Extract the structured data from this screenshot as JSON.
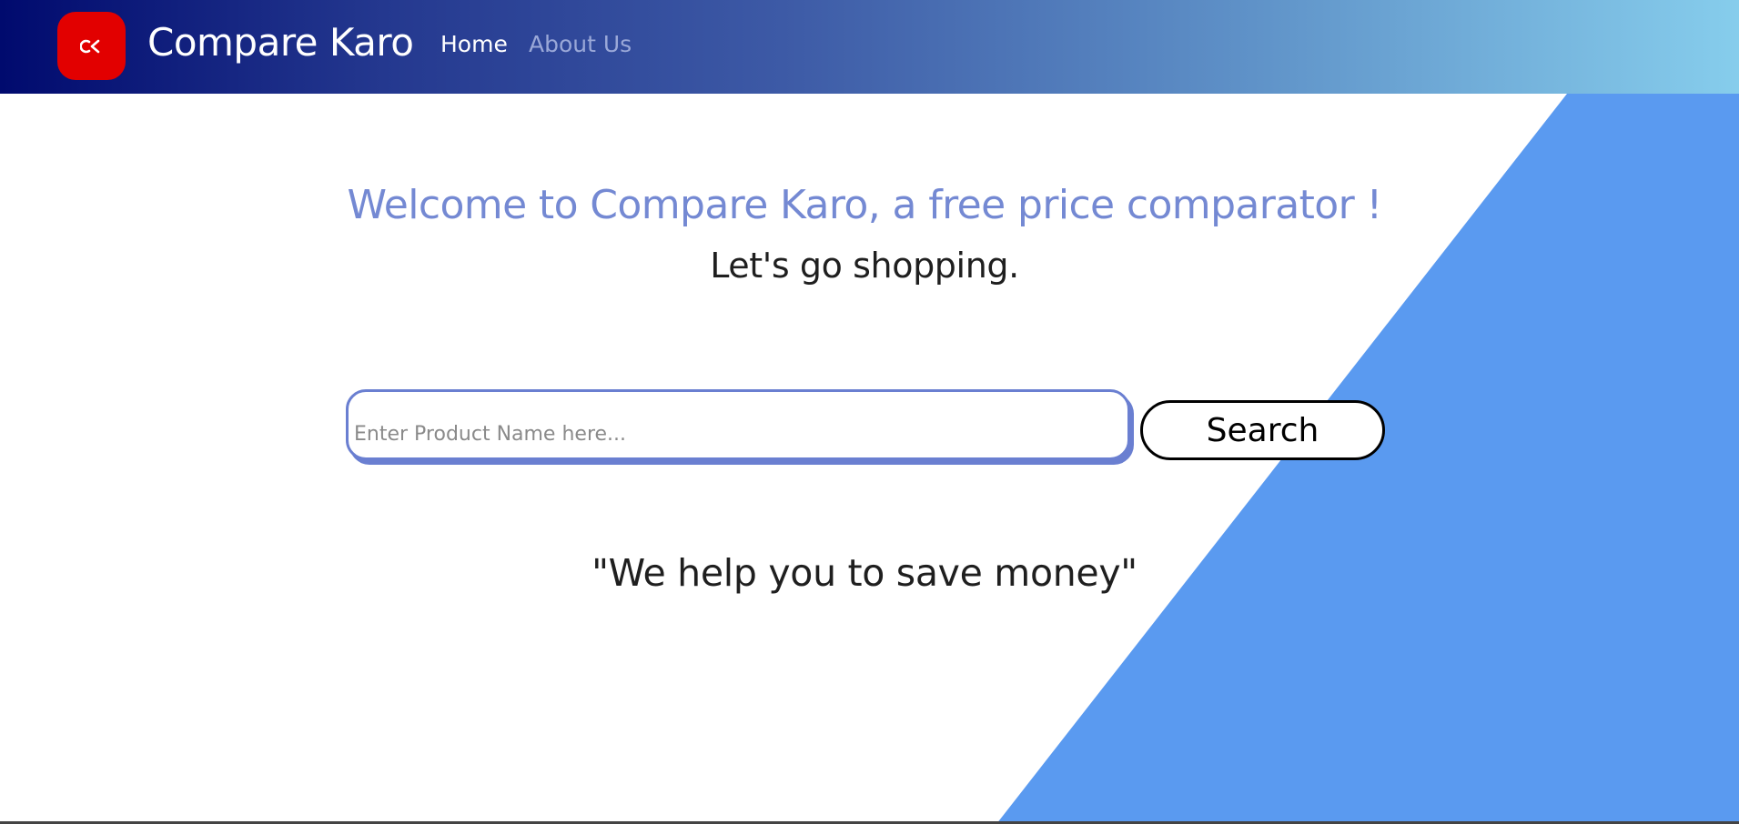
{
  "header": {
    "logo_text": "ck",
    "brand": "Compare Karo",
    "nav": {
      "home": "Home",
      "about": "About Us"
    }
  },
  "main": {
    "headline": "Welcome to Compare Karo, a free price comparator !",
    "subline": "Let's go shopping.",
    "search": {
      "placeholder": "Enter Product Name here...",
      "value": "",
      "button_label": "Search"
    },
    "tagline": "\"We help you to save money\""
  },
  "colors": {
    "accent": "#7489d3",
    "logo_bg": "#e20000",
    "background_shape": "#5a9af0"
  }
}
